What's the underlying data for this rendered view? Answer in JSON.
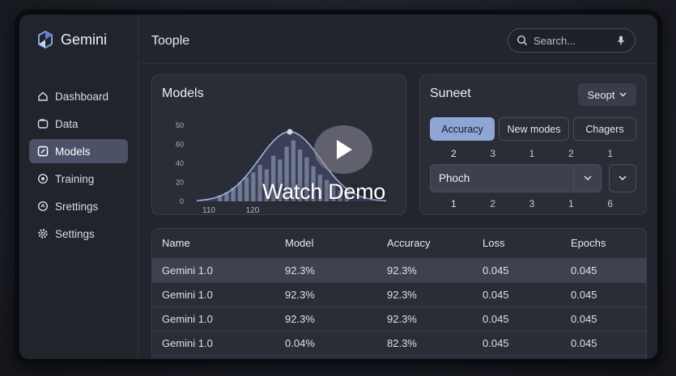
{
  "app": {
    "name": "Gemini",
    "header_title": "Toople"
  },
  "search": {
    "placeholder": "Search..."
  },
  "sidebar": {
    "items": [
      {
        "label": "Dashboard",
        "icon": "home-icon"
      },
      {
        "label": "Data",
        "icon": "folder-icon"
      },
      {
        "label": "Models",
        "icon": "model-icon",
        "active": true
      },
      {
        "label": "Training",
        "icon": "training-icon"
      },
      {
        "label": "Srettings",
        "icon": "sliders-icon"
      },
      {
        "label": "Settings",
        "icon": "gear-icon"
      }
    ]
  },
  "models_panel": {
    "title": "Models",
    "chart_data": {
      "type": "area",
      "y_ticks": [
        "50",
        "60",
        "40",
        "20",
        "0"
      ],
      "x_ticks": [
        "110",
        "120"
      ],
      "curve_peak": 1.0,
      "bars": [
        0.08,
        0.12,
        0.18,
        0.25,
        0.32,
        0.38,
        0.48,
        0.42,
        0.6,
        0.55,
        0.72,
        0.8,
        0.68,
        0.58,
        0.46,
        0.35,
        0.28,
        0.2,
        0.14,
        0.1
      ]
    }
  },
  "suneet_panel": {
    "title": "Suneet",
    "select_label": "Seopt",
    "tabs": [
      "Accuracy",
      "New modes",
      "Chagers"
    ],
    "row1_numbers": [
      "2",
      "3",
      "1",
      "2",
      "1"
    ],
    "field_value": "Phoch",
    "row2_numbers": [
      "1",
      "2",
      "3",
      "1",
      "6"
    ]
  },
  "table": {
    "headers": [
      "Name",
      "Model",
      "Accuracy",
      "Loss",
      "Epochs"
    ],
    "rows": [
      [
        "Gemini 1.0",
        "92.3%",
        "92.3%",
        "0.045",
        "0.045"
      ],
      [
        "Gemini 1.0",
        "92.3%",
        "92.3%",
        "0.045",
        "0.045"
      ],
      [
        "Gemini 1.0",
        "92.3%",
        "92.3%",
        "0.045",
        "0.045"
      ],
      [
        "Gemini 1.0",
        "0.04%",
        "82.3%",
        "0.045",
        "0.045"
      ]
    ]
  },
  "overlay": {
    "caption": "Watch Demo"
  },
  "colors": {
    "accent": "#8fa6d4",
    "active_nav": "#4b5268"
  }
}
